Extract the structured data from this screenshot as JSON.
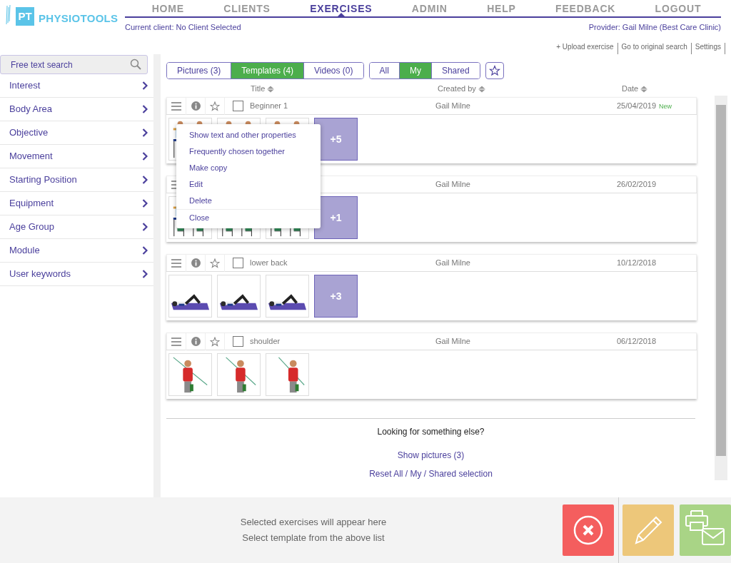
{
  "logo": {
    "badge": "PT",
    "name": "PHYSIOTOOLS"
  },
  "nav": [
    {
      "label": "HOME",
      "selected": false
    },
    {
      "label": "CLIENTS",
      "selected": false
    },
    {
      "label": "EXERCISES",
      "selected": true
    },
    {
      "label": "ADMIN",
      "selected": false
    },
    {
      "label": "HELP",
      "selected": false
    },
    {
      "label": "FEEDBACK",
      "selected": false
    },
    {
      "label": "LOGOUT",
      "selected": false
    }
  ],
  "current_client": "Current client: No Client Selected",
  "provider": "Provider: Gail Milne (Best Care Clinic)",
  "links": [
    "+ Upload exercise",
    "Go to original search",
    "Settings"
  ],
  "search": {
    "placeholder": "Free text search"
  },
  "sidebar": {
    "items": [
      "Interest",
      "Body Area",
      "Objective",
      "Movement",
      "Starting Position",
      "Equipment",
      "Age Group",
      "Module",
      "User keywords"
    ]
  },
  "type_tabs": [
    {
      "label": "Pictures (3)",
      "selected": false
    },
    {
      "label": "Templates (4)",
      "selected": true
    },
    {
      "label": "Videos (0)",
      "selected": false
    }
  ],
  "owner_tabs": [
    {
      "label": "All",
      "selected": false
    },
    {
      "label": "My",
      "selected": true
    },
    {
      "label": "Shared",
      "selected": false
    }
  ],
  "columns": [
    "Title",
    "Created by",
    "Date"
  ],
  "templates": [
    {
      "title": "Beginner 1",
      "created_by": "Gail Milne",
      "date": "25/04/2019",
      "badge": "New",
      "checked": false,
      "more": "+5"
    },
    {
      "created_by": "Gail Milne",
      "date": "26/02/2019",
      "more": "+1"
    },
    {
      "title": "lower back",
      "created_by": "Gail Milne",
      "date": "10/12/2018",
      "checked": false,
      "more": "+3"
    },
    {
      "title": "shoulder",
      "created_by": "Gail Milne",
      "date": "06/12/2018",
      "checked": false
    }
  ],
  "context_menu": {
    "items": [
      "Show text and other properties",
      "Frequently chosen together",
      "Make copy",
      "Edit",
      "Delete",
      "Close"
    ]
  },
  "more_section": {
    "heading": "Looking for something else?",
    "links": [
      "Show pictures (3)",
      "Reset All / My / Shared selection"
    ]
  },
  "footer": {
    "lines": [
      "Selected exercises will appear here",
      "Select template from the above list"
    ]
  }
}
